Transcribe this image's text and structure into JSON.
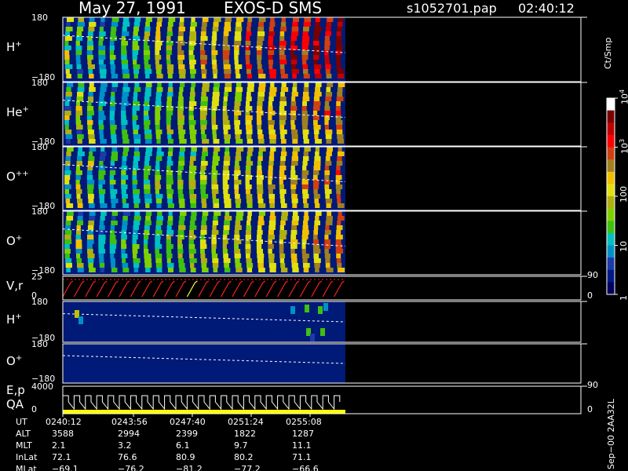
{
  "header": {
    "date": "May 27, 1991",
    "instrument": "EXOS-D SMS",
    "file": "s1052701.pap",
    "time": "02:40:12"
  },
  "colorbar": {
    "unit": "Ct/Smp",
    "ticks": [
      {
        "label": "10",
        "sup": "4",
        "value": 10000
      },
      {
        "label": "10",
        "sup": "3",
        "value": 1000
      },
      {
        "label": "100",
        "sup": "",
        "value": 100
      },
      {
        "label": "10",
        "sup": "",
        "value": 10
      },
      {
        "label": "1",
        "sup": "",
        "value": 1
      }
    ],
    "colors": [
      "#000060",
      "#001a88",
      "#1c3aa8",
      "#0090c8",
      "#00c0c0",
      "#40c010",
      "#80d000",
      "#b0b010",
      "#e0e010",
      "#f0c000",
      "#a08020",
      "#d04010",
      "#ff0000",
      "#c00000",
      "#7a0000",
      "#ffffff"
    ]
  },
  "panels": [
    {
      "label": "H",
      "sup": "+",
      "ymax": "180",
      "ymin": "−180",
      "intensity": 1.0
    },
    {
      "label": "He",
      "sup": "+",
      "ymax": "180",
      "ymin": "−180",
      "intensity": 0.8
    },
    {
      "label": "O",
      "sup": "++",
      "ymax": "180",
      "ymin": "−180",
      "intensity": 0.75
    },
    {
      "label": "O",
      "sup": "+",
      "ymax": "180",
      "ymin": "−180",
      "intensity": 0.75
    },
    {
      "label": "V,r",
      "sup": "",
      "ymax": "25",
      "ymin": "0",
      "right_top": "90",
      "right_bottom": "0"
    },
    {
      "label": "H",
      "sup": "+",
      "ymax": "180",
      "ymin": "−180"
    },
    {
      "label": "O",
      "sup": "+",
      "ymax": "180",
      "ymin": "−180"
    },
    {
      "label": "E,p",
      "label2": "QA",
      "ymax": "4000",
      "ymin": "0",
      "right_top": "90",
      "right_bottom": "0"
    }
  ],
  "side_label": "Sep−00  2AA32L",
  "table": {
    "row_labels": [
      "UT",
      "ALT",
      "MLT",
      "InLat",
      "MLat"
    ],
    "columns": [
      [
        "0240:12",
        "3588",
        "2.1",
        "72.1",
        "−69.1"
      ],
      [
        "0243:56",
        "2994",
        "3.2",
        "76.6",
        "−76.2"
      ],
      [
        "0247:40",
        "2399",
        "6.1",
        "80.9",
        "−81.2"
      ],
      [
        "0251:24",
        "1822",
        "9.7",
        "80.2",
        "−77.2"
      ],
      [
        "0255:08",
        "1287",
        "11.1",
        "71.1",
        "−66.6"
      ]
    ]
  },
  "chart_data": {
    "type": "heatmap",
    "title": "May 27, 1991   EXOS-D SMS",
    "xlabel": "UT",
    "x_ticks": [
      "0240:12",
      "0243:56",
      "0247:40",
      "0251:24",
      "0255:08"
    ],
    "n_spins": 25,
    "panels": [
      {
        "name": "H+",
        "ylim": [
          -180,
          180
        ]
      },
      {
        "name": "He+",
        "ylim": [
          -180,
          180
        ]
      },
      {
        "name": "O++",
        "ylim": [
          -180,
          180
        ]
      },
      {
        "name": "O+",
        "ylim": [
          -180,
          180
        ]
      },
      {
        "name": "V,r",
        "ylim": [
          0,
          25
        ],
        "right_ylim": [
          0,
          90
        ]
      },
      {
        "name": "H+",
        "ylim": [
          -180,
          180
        ]
      },
      {
        "name": "O+",
        "ylim": [
          -180,
          180
        ]
      },
      {
        "name": "E,p / QA",
        "ylim": [
          0,
          4000
        ],
        "right_ylim": [
          0,
          90
        ]
      }
    ],
    "colorbar": {
      "label": "Ct/Smp",
      "scale": "log",
      "range": [
        1,
        10000
      ]
    }
  }
}
